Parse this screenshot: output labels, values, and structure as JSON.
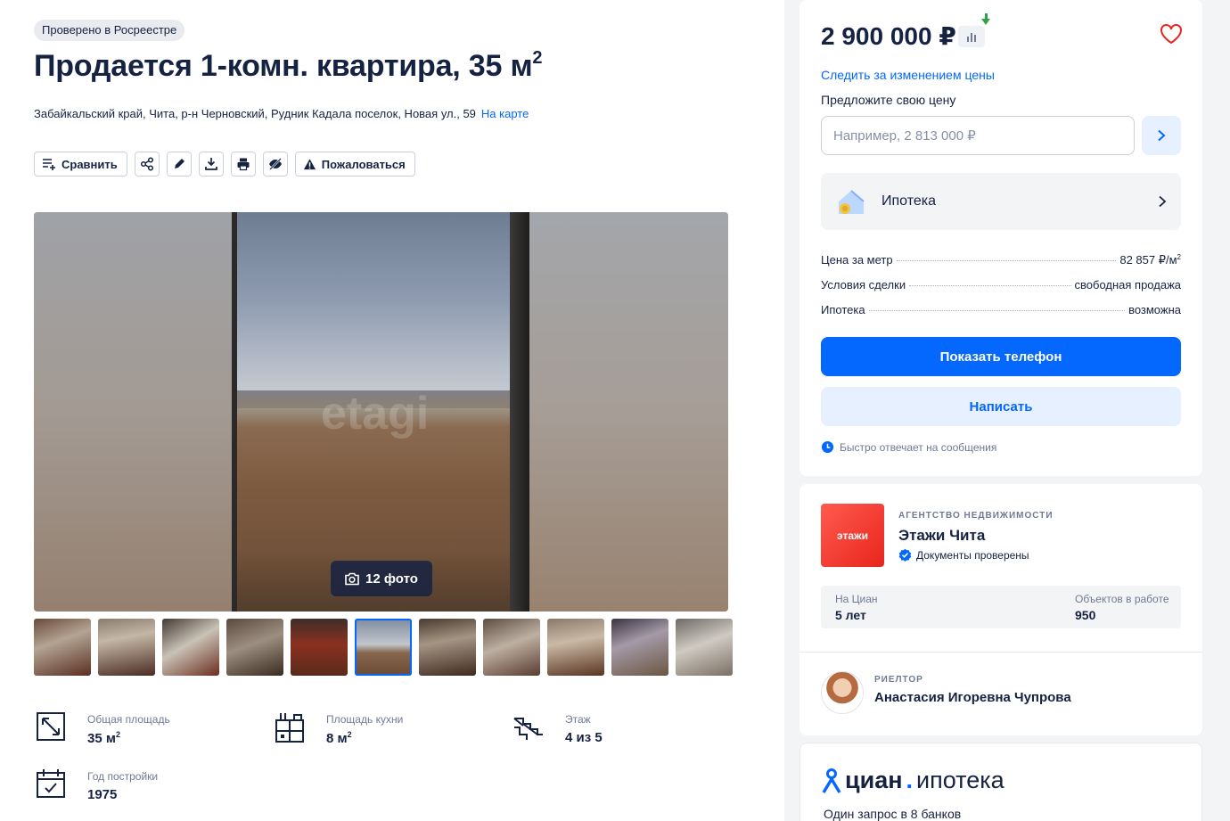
{
  "listing": {
    "badge": "Проверено в Росреестре",
    "title": "Продается 1-комн. квартира, 35 м",
    "title_sup": "2",
    "address": "Забайкальский край, Чита, р-н Черновский, Рудник Кадала поселок, Новая ул., 59",
    "map_link": "На карте"
  },
  "actions": {
    "compare": "Сравнить",
    "complain": "Пожаловаться"
  },
  "gallery": {
    "photo_count": "12 фото",
    "watermark": "etagi",
    "thumbnails_count": 11,
    "active_thumbnail": 6
  },
  "facts": {
    "area": {
      "label": "Общая площадь",
      "value": "35 м",
      "sup": "2"
    },
    "kitchen": {
      "label": "Площадь кухни",
      "value": "8 м",
      "sup": "2"
    },
    "floor": {
      "label": "Этаж",
      "value": "4 из 5"
    },
    "year": {
      "label": "Год постройки",
      "value": "1975"
    }
  },
  "offer_card": {
    "price": "2 900 000 ₽",
    "follow_price": "Следить за изменением цены",
    "offer_label": "Предложите свою цену",
    "offer_placeholder": "Например, 2 813 000 ₽",
    "mortgage_label": "Ипотека",
    "rows": [
      {
        "key": "Цена за метр",
        "value": "82 857 ₽/м",
        "sup": "2"
      },
      {
        "key": "Условия сделки",
        "value": "свободная продажа"
      },
      {
        "key": "Ипотека",
        "value": "возможна"
      }
    ],
    "show_phone": "Показать телефон",
    "write": "Написать",
    "fast_reply": "Быстро отвечает на сообщения"
  },
  "agency": {
    "logo_text": "этажи",
    "caption": "АГЕНТСТВО НЕДВИЖИМОСТИ",
    "name": "Этажи Чита",
    "docs": "Документы проверены",
    "stat1_label": "На Циан",
    "stat1_value": "5 лет",
    "stat2_label": "Объектов в работе",
    "stat2_value": "950",
    "realtor_caption": "РИЕЛТОР",
    "realtor_name": "Анастасия Игоревна Чупрова"
  },
  "promo": {
    "brand": "циан",
    "brand_suffix": "ипотека",
    "subtitle": "Один запрос в 8 банков"
  },
  "colors": {
    "accent": "#0468ff",
    "text": "#152242",
    "muted": "#707a95",
    "agency_red": "#e8261d"
  }
}
